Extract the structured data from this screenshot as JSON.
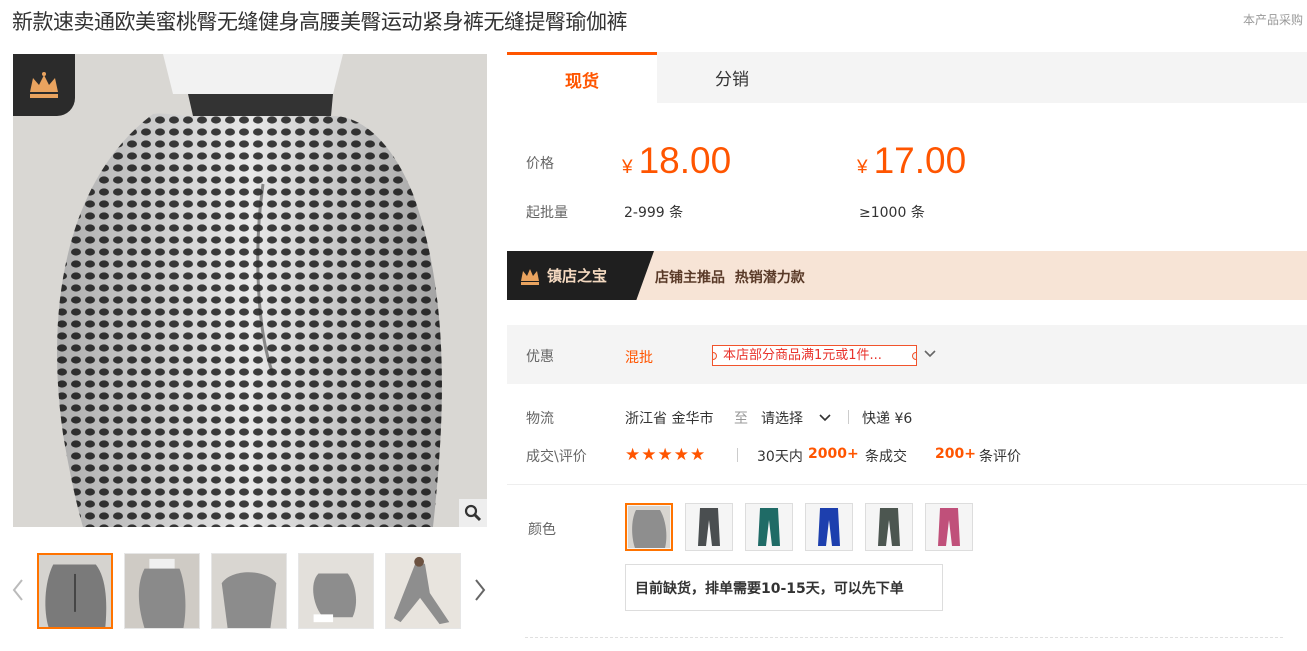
{
  "product": {
    "title": "新款速卖通欧美蜜桃臀无缝健身高腰美臀运动紧身裤无缝提臀瑜伽裤",
    "side_note": "本产品采购"
  },
  "gallery": {
    "badge_icon": "crown-icon",
    "zoom_icon": "magnifier-icon",
    "prev_icon": "chevron-left-icon",
    "next_icon": "chevron-right-icon",
    "thumbnail_count": 5
  },
  "tabs": [
    {
      "label": "现货",
      "active": true
    },
    {
      "label": "分销",
      "active": false
    }
  ],
  "pricing": {
    "price_label": "价格",
    "moq_label": "起批量",
    "currency_symbol": "¥",
    "tiers": [
      {
        "price": "18.00",
        "range": "2-999",
        "unit": "条"
      },
      {
        "price": "17.00",
        "range": "≥1000",
        "unit": "条"
      }
    ]
  },
  "treasure": {
    "badge_label": "镇店之宝",
    "tags": "店铺主推品  热销潜力款"
  },
  "promotion": {
    "label": "优惠",
    "type": "混批",
    "coupon": "本店部分商品满1元或1件..."
  },
  "logistics": {
    "label": "物流",
    "origin": "浙江省 金华市",
    "to": "至",
    "destination_select": "请选择",
    "shipping": "快递 ¥6"
  },
  "reviews": {
    "label": "成交\\评价",
    "rating_stars": 5,
    "days_text": "30天内",
    "deals_count": "2000+",
    "deals_suffix": "条成交",
    "review_count": "200+",
    "review_suffix": "条评价"
  },
  "variants": {
    "label": "颜色",
    "swatches": [
      {
        "name": "grey-honeycomb",
        "color": "#9b9b9b",
        "selected": true
      },
      {
        "name": "dark-grey",
        "color": "#4a4e50",
        "selected": false
      },
      {
        "name": "teal",
        "color": "#1f6b66",
        "selected": false
      },
      {
        "name": "royal-blue",
        "color": "#1d3fae",
        "selected": false
      },
      {
        "name": "olive-grey",
        "color": "#4c5650",
        "selected": false
      },
      {
        "name": "rose",
        "color": "#c0507a",
        "selected": false
      }
    ],
    "stock_note": "目前缺货，排单需要10-15天，可以先下单"
  },
  "colors": {
    "accent": "#ff5500",
    "treasure_bg": "#f7e4d6"
  }
}
